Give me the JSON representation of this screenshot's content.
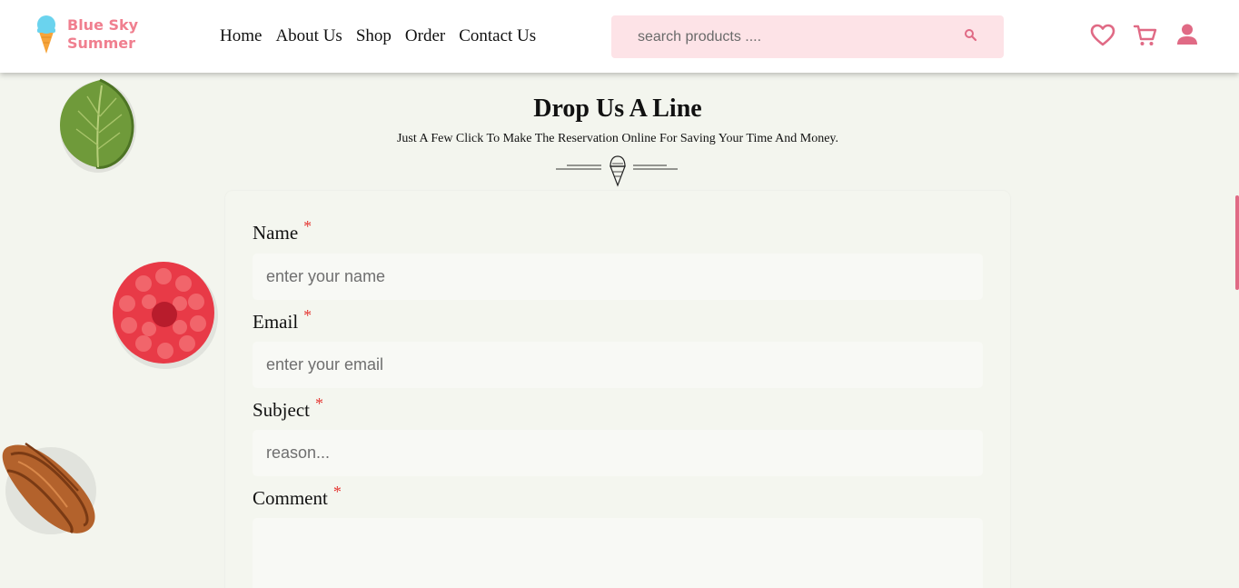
{
  "brand": {
    "line1": "Blue Sky",
    "line2": "Summer"
  },
  "nav": {
    "items": [
      {
        "label": "Home"
      },
      {
        "label": "About Us"
      },
      {
        "label": "Shop"
      },
      {
        "label": "Order"
      },
      {
        "label": "Contact Us"
      }
    ]
  },
  "search": {
    "placeholder": "search products ...."
  },
  "header_icons": [
    "heart-icon",
    "cart-icon",
    "user-icon"
  ],
  "colors": {
    "accent": "#e06a85",
    "search_bg": "#fde3e7",
    "page_bg": "#f3f5ee",
    "required": "#e53935",
    "logo_text": "#f07f8f"
  },
  "contact": {
    "title": "Drop Us A Line",
    "subtitle": "Just A Few Click To Make The Reservation Online For Saving Your Time And Money.",
    "required_mark": "*",
    "fields": {
      "name": {
        "label": "Name",
        "placeholder": "enter your name"
      },
      "email": {
        "label": "Email",
        "placeholder": "enter your email"
      },
      "subject": {
        "label": "Subject",
        "placeholder": "reason..."
      },
      "comment": {
        "label": "Comment",
        "placeholder": ""
      }
    }
  }
}
